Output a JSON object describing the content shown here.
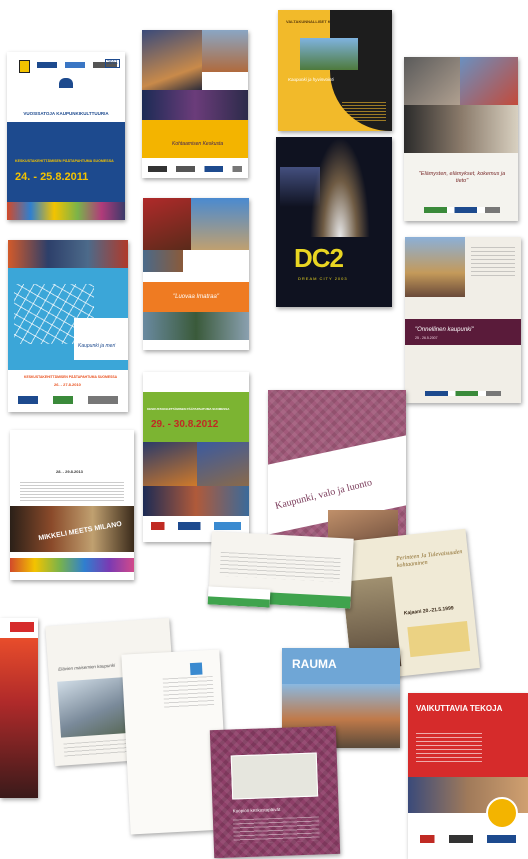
{
  "posters": {
    "p1": {
      "header": "VUOSISATOJA KAUPUNKIKULTTUURIA",
      "event_line": "KESKUSTAKEHITTÄMISEN PÄÄTAPAHTUMA SUOMESSA",
      "dates": "24. - 25.8.2011",
      "year_badge": "2011",
      "colors": {
        "bg": "#1d4a8e",
        "top": "#ffffff",
        "accent": "#f3c300"
      }
    },
    "p2": {
      "title": "Kohtaamisen Keskusta",
      "colors": {
        "band": "#f3b400",
        "photo": "#2c2b4a"
      }
    },
    "p3": {
      "series": "VALTAKUNNALLISET KESKUSTAPÄIVÄT",
      "subtitle": "Kaupunki ja hyvinvointi",
      "colors": {
        "bg": "#f2ba2a",
        "film": "#1d1d1d"
      }
    },
    "p4": {
      "quote": "\"Elämysten, elämykset, kokemus ja tieto\"",
      "colors": {
        "bg": "#f4f3ee",
        "accent": "#c0392b"
      }
    },
    "p5": {
      "brand": "DC2",
      "tagline": "DREAM CITY 2003",
      "colors": {
        "bg": "#0f1220",
        "logo": "#e9d622"
      }
    },
    "p6": {
      "title": "\"Onnellinen kaupunki\"",
      "dates": "25 - 26.5.2007",
      "colors": {
        "band": "#5a1b3a",
        "bg": "#f1eee7"
      }
    },
    "p7": {
      "title": "Kaupunki ja meri",
      "event_line": "KESKUSTAKEHITTÄMISEN PÄÄTAPAHTUMA SUOMESSA",
      "dates": "26. - 27.8.2010",
      "colors": {
        "map": "#3ba6d8",
        "accent": "#e94f1c"
      }
    },
    "p8": {
      "title": "\"Luovaa Imatraa\"",
      "colors": {
        "band": "#ef7b22"
      }
    },
    "p9": {
      "event_line": "KESKUSTAKEHITTÄMISEN PÄÄTAPAHTUMA SUOMESSA",
      "dates": "29. - 30.8.2012",
      "colors": {
        "band": "#7cb432",
        "dates": "#c02a23"
      }
    },
    "p10": {
      "dates": "28. - 29.8.2013",
      "banner": "MIKKELI MEETS MILANO",
      "colors": {
        "bg": "#ffffff",
        "banner": "#2c2c2c"
      }
    },
    "p11": {
      "title": "Kaupunki, valo ja luonto",
      "colors": {
        "paving": "#a25a7b"
      }
    },
    "p12": {
      "title": "Perinteen Ja Tulevaisuuden kohtaaminen",
      "place": "Kajaani 20.-21.5.1999",
      "colors": {
        "bg": "#f0ead6"
      }
    },
    "p13": {
      "heading": "RAUMA",
      "colors": {
        "sky": "#6fa6d6"
      }
    },
    "p14": {
      "title": "VAIKUTTAVIA TEKOJA",
      "colors": {
        "bg": "#d62b2b"
      }
    },
    "p15": {
      "title": "Elävien maisemien kaupunki",
      "colors": {
        "bg": "#f6f4ef"
      }
    },
    "p16": {
      "title": "Kuopion keskustapäivät",
      "colors": {
        "paving": "#8e3f68"
      }
    },
    "p17": {
      "colors": {
        "bg": "#e84d2b"
      }
    },
    "p18": {
      "colors": {
        "band": "#3fa34d"
      }
    }
  }
}
